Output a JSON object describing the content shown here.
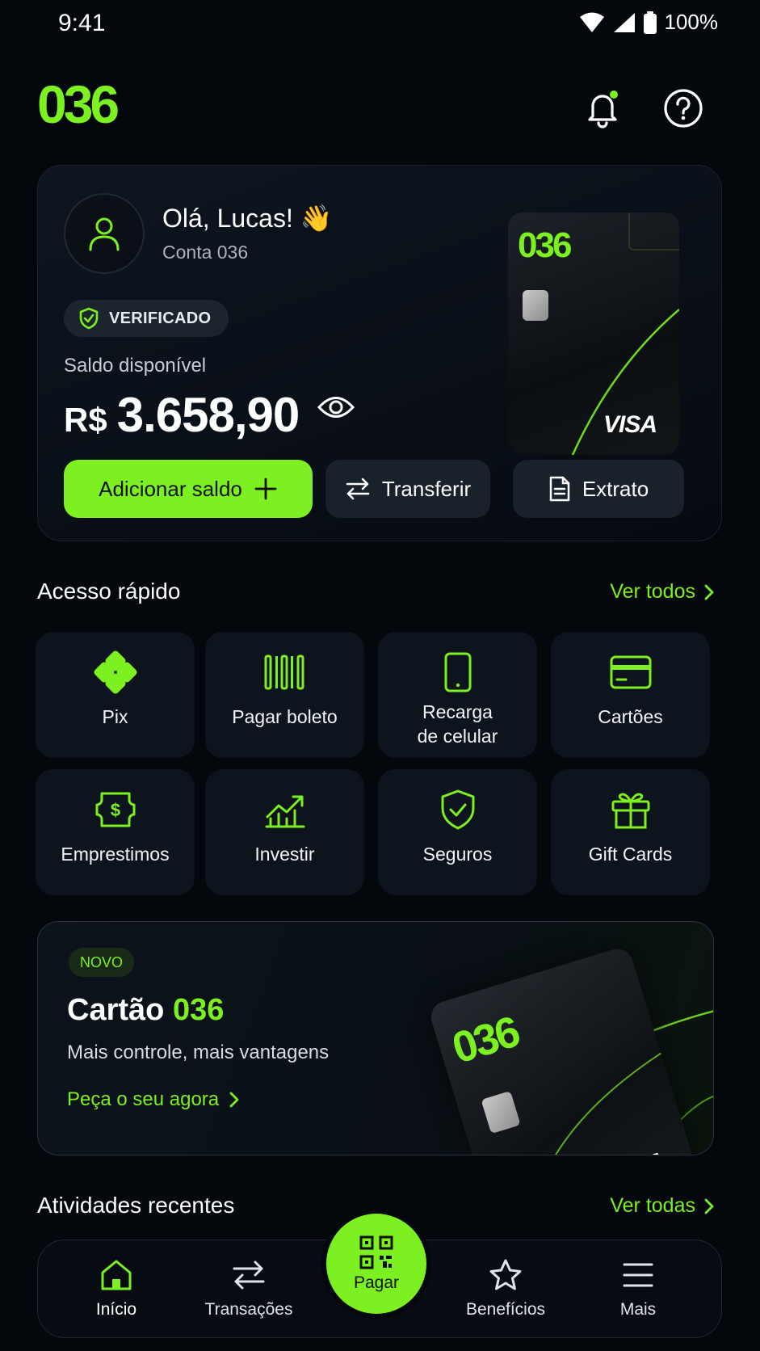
{
  "status_bar": {
    "time": "9:41",
    "battery": "100%",
    "icons": [
      "wifi-icon",
      "signal-icon",
      "battery-icon"
    ]
  },
  "header": {
    "logo": "036",
    "icons": [
      "bell-icon",
      "help-icon"
    ]
  },
  "account": {
    "greeting": "Olá, Lucas! 👋",
    "subtitle": "Conta 036",
    "badge": "VERIFICADO",
    "balance_label": "Saldo disponível",
    "currency": "R$",
    "balance": "3.658,90",
    "card": {
      "logo": "036",
      "brand": "VISA"
    },
    "actions": {
      "add": "Adicionar saldo",
      "transfer": "Transferir",
      "statement": "Extrato"
    }
  },
  "quick_access": {
    "title": "Acesso rápido",
    "link": "Ver todos",
    "items": [
      {
        "label": "Pix",
        "icon": "pix-icon"
      },
      {
        "label": "Pagar boleto",
        "icon": "barcode-icon"
      },
      {
        "label": "Recarga\nde celular",
        "icon": "phone-icon"
      },
      {
        "label": "Cartões",
        "icon": "card-icon"
      },
      {
        "label": "Emprestimos",
        "icon": "loan-icon"
      },
      {
        "label": "Investir",
        "icon": "chart-icon"
      },
      {
        "label": "Seguros",
        "icon": "shield-icon"
      },
      {
        "label": "Gift Cards",
        "icon": "gift-icon"
      }
    ]
  },
  "promo": {
    "badge": "NOVO",
    "title": "Cartão",
    "title_highlight": "036",
    "subtitle": "Mais controle, mais vantagens",
    "cta": "Peça o seu agora",
    "card": {
      "logo": "036",
      "brand": "VISA"
    }
  },
  "recent": {
    "title": "Atividades recentes",
    "link": "Ver todas"
  },
  "nav": {
    "items": [
      {
        "label": "Início",
        "icon": "home-icon"
      },
      {
        "label": "Transações",
        "icon": "transfer-icon"
      },
      {
        "label": "Pagar",
        "icon": "qr-icon"
      },
      {
        "label": "Benefícios",
        "icon": "star-icon"
      },
      {
        "label": "Mais",
        "icon": "menu-icon"
      }
    ]
  },
  "colors": {
    "accent": "#7cf021",
    "background": "#04070c",
    "surface": "#0e141d"
  }
}
